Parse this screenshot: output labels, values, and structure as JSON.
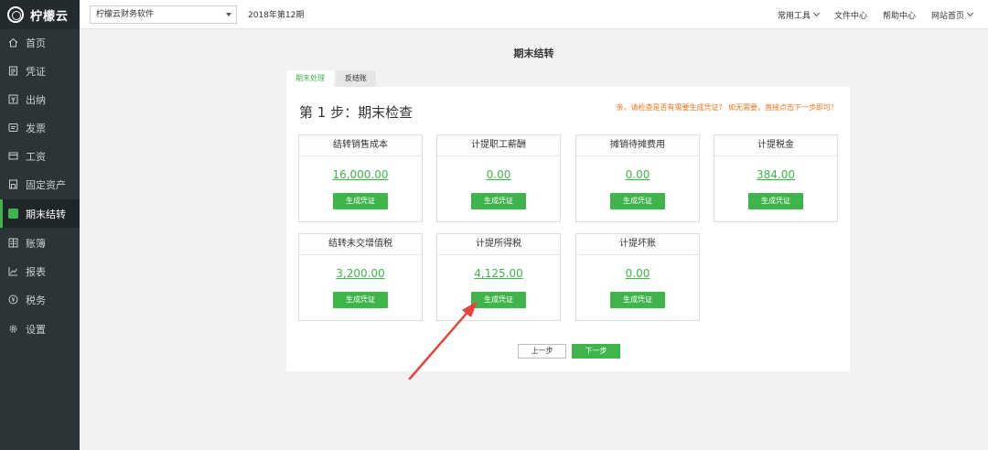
{
  "app": {
    "name": "柠檬云"
  },
  "sidebar": {
    "items": [
      {
        "label": "首页",
        "icon": "home-icon"
      },
      {
        "label": "凭证",
        "icon": "voucher-icon"
      },
      {
        "label": "出纳",
        "icon": "cashier-icon"
      },
      {
        "label": "发票",
        "icon": "invoice-icon"
      },
      {
        "label": "工资",
        "icon": "salary-icon"
      },
      {
        "label": "固定资产",
        "icon": "asset-icon"
      },
      {
        "label": "期末结转",
        "icon": "closing-icon",
        "active": true
      },
      {
        "label": "账簿",
        "icon": "ledger-icon"
      },
      {
        "label": "报表",
        "icon": "report-icon"
      },
      {
        "label": "税务",
        "icon": "tax-icon"
      },
      {
        "label": "设置",
        "icon": "settings-icon"
      }
    ]
  },
  "topbar": {
    "company": "柠檬云财务软件",
    "period": "2018年第12期",
    "links": [
      "常用工具",
      "文件中心",
      "帮助中心",
      "网站首页"
    ]
  },
  "main": {
    "title": "期末结转",
    "tabs": [
      "期末处理",
      "反结账"
    ],
    "step_title": "第 1 步：期末检查",
    "hint": "亲，请检查是否有需要生成凭证？ 如无需要，直接点击下一步即可！",
    "cards": [
      {
        "title": "结转销售成本",
        "value": "16,000.00",
        "button": "生成凭证"
      },
      {
        "title": "计提职工薪酬",
        "value": "0.00",
        "button": "生成凭证"
      },
      {
        "title": "摊销待摊费用",
        "value": "0.00",
        "button": "生成凭证"
      },
      {
        "title": "计提税金",
        "value": "384.00",
        "button": "生成凭证"
      },
      {
        "title": "结转未交增值税",
        "value": "3,200.00",
        "button": "生成凭证"
      },
      {
        "title": "计提所得税",
        "value": "4,125.00",
        "button": "生成凭证"
      },
      {
        "title": "计提坏账",
        "value": "0.00",
        "button": "生成凭证"
      }
    ],
    "prev_button": "上一步",
    "next_button": "下一步"
  },
  "colors": {
    "accent": "#3fb44a",
    "sidebar_bg": "#2b3437",
    "hint": "#f0751b",
    "annotation_arrow": "#e8433a"
  }
}
